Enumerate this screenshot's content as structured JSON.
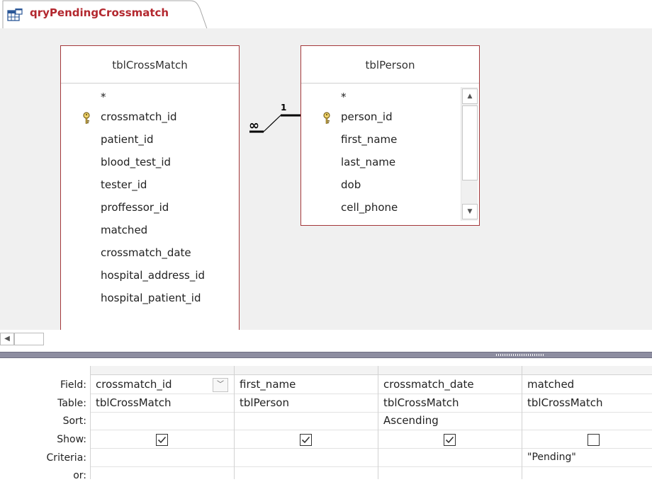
{
  "tab": {
    "title": "qryPendingCrossmatch"
  },
  "tables": [
    {
      "name": "tblCrossMatch",
      "fields": [
        {
          "name": "*",
          "key": false
        },
        {
          "name": "crossmatch_id",
          "key": true
        },
        {
          "name": "patient_id",
          "key": false
        },
        {
          "name": "blood_test_id",
          "key": false
        },
        {
          "name": "tester_id",
          "key": false
        },
        {
          "name": "proffessor_id",
          "key": false
        },
        {
          "name": "matched",
          "key": false
        },
        {
          "name": "crossmatch_date",
          "key": false
        },
        {
          "name": "hospital_address_id",
          "key": false
        },
        {
          "name": "hospital_patient_id",
          "key": false
        }
      ]
    },
    {
      "name": "tblPerson",
      "fields": [
        {
          "name": "*",
          "key": false
        },
        {
          "name": "person_id",
          "key": true
        },
        {
          "name": "first_name",
          "key": false
        },
        {
          "name": "last_name",
          "key": false
        },
        {
          "name": "dob",
          "key": false
        },
        {
          "name": "cell_phone",
          "key": false
        }
      ]
    }
  ],
  "relationship": {
    "many_symbol": "∞",
    "one_symbol": "1"
  },
  "grid": {
    "row_labels": [
      "Field:",
      "Table:",
      "Sort:",
      "Show:",
      "Criteria:",
      "or:"
    ],
    "columns": [
      {
        "field": "crossmatch_id",
        "table": "tblCrossMatch",
        "sort": "",
        "show": true,
        "criteria": "",
        "has_dropdown": true
      },
      {
        "field": "first_name",
        "table": "tblPerson",
        "sort": "",
        "show": true,
        "criteria": ""
      },
      {
        "field": "crossmatch_date",
        "table": "tblCrossMatch",
        "sort": "Ascending",
        "show": true,
        "criteria": ""
      },
      {
        "field": "matched",
        "table": "tblCrossMatch",
        "sort": "",
        "show": false,
        "criteria": "\"Pending\""
      }
    ]
  },
  "colors": {
    "accent": "#b3282f",
    "table_border": "#a4373a",
    "splitter": "#8d8da0"
  },
  "icons": {
    "tab": "query-icon",
    "key": "primary-key-icon",
    "dropdown": "chevron-down-icon"
  }
}
